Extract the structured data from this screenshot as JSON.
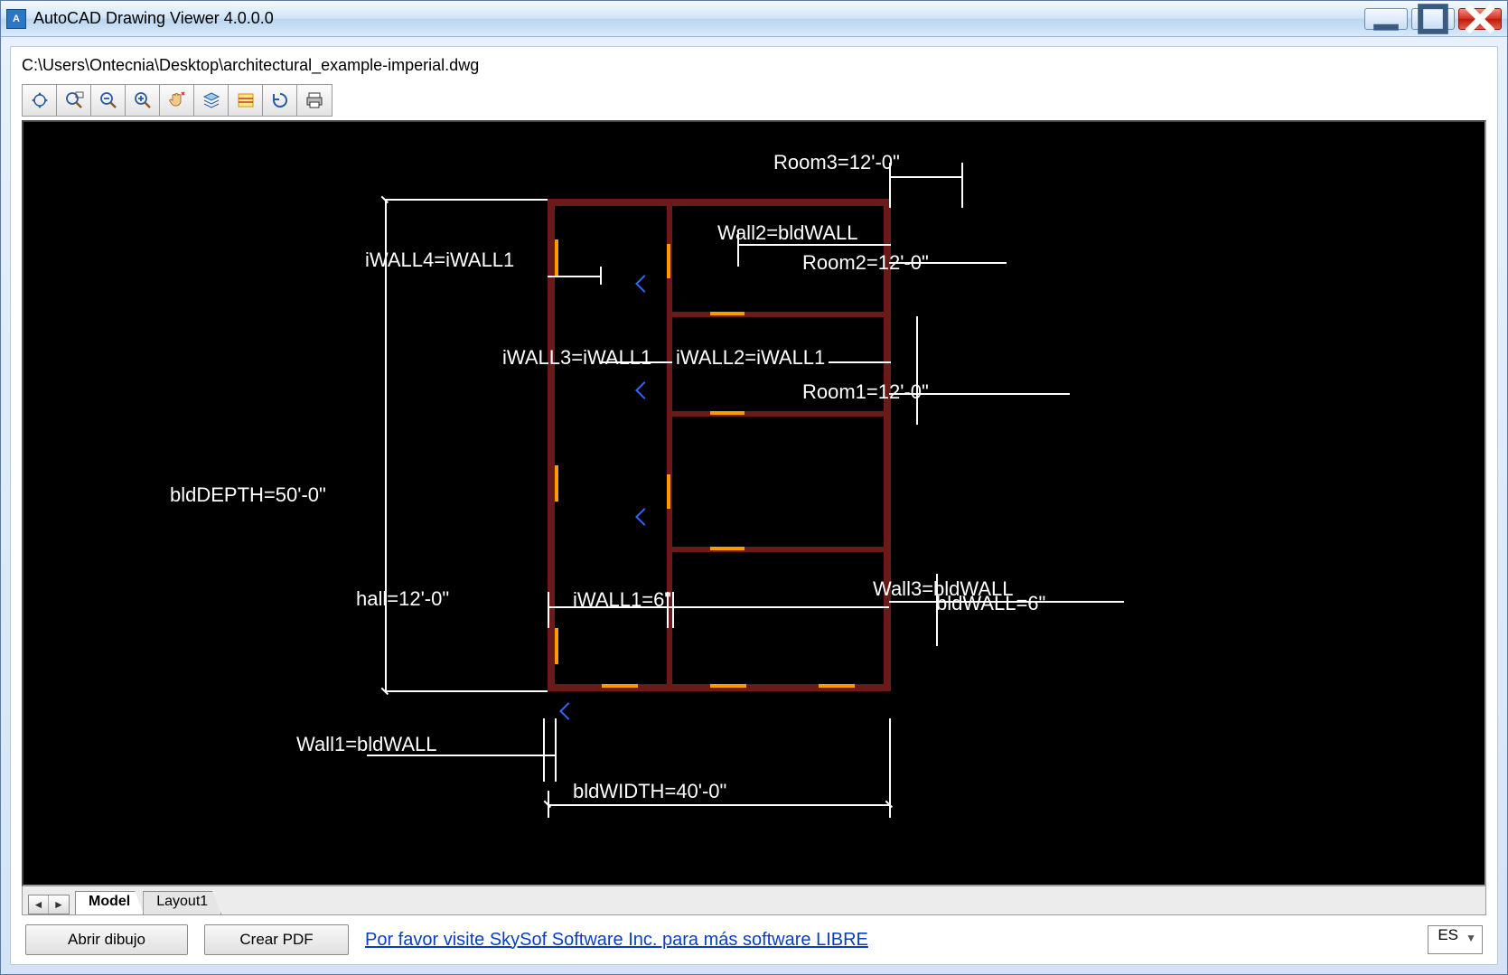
{
  "titlebar": {
    "title": "AutoCAD Drawing Viewer 4.0.0.0"
  },
  "file_path": "C:\\Users\\Ontecnia\\Desktop\\architectural_example-imperial.dwg",
  "toolbar": {
    "items": [
      "pan",
      "zoom-extents",
      "zoom-out",
      "zoom-in",
      "hand",
      "layers",
      "properties",
      "refresh",
      "print"
    ]
  },
  "drawing": {
    "dimensions": {
      "blddepth": "bldDEPTH=50'-0\"",
      "bldwidth": "bldWIDTH=40'-0\"",
      "iwall4": "iWALL4=iWALL1",
      "iwall3": "iWALL3=iWALL1",
      "iwall2": "iWALL2=iWALL1",
      "iwall1": "iWALL1=6\"",
      "hall": "hall=12'-0\"",
      "wall1": "Wall1=bldWALL",
      "wall2": "Wall2=bldWALL",
      "wall3": "Wall3=bldWALL",
      "room1": "Room1=12'-0\"",
      "room2": "Room2=12'-0\"",
      "room3": "Room3=12'-0\"",
      "bldwall": "bldWALL=6\""
    }
  },
  "tabs": {
    "model": "Model",
    "layout1": "Layout1"
  },
  "buttons": {
    "open": "Abrir dibujo",
    "pdf": "Crear PDF"
  },
  "link_text": "Por favor visite SkySof Software Inc. para más software LIBRE",
  "language": "ES"
}
